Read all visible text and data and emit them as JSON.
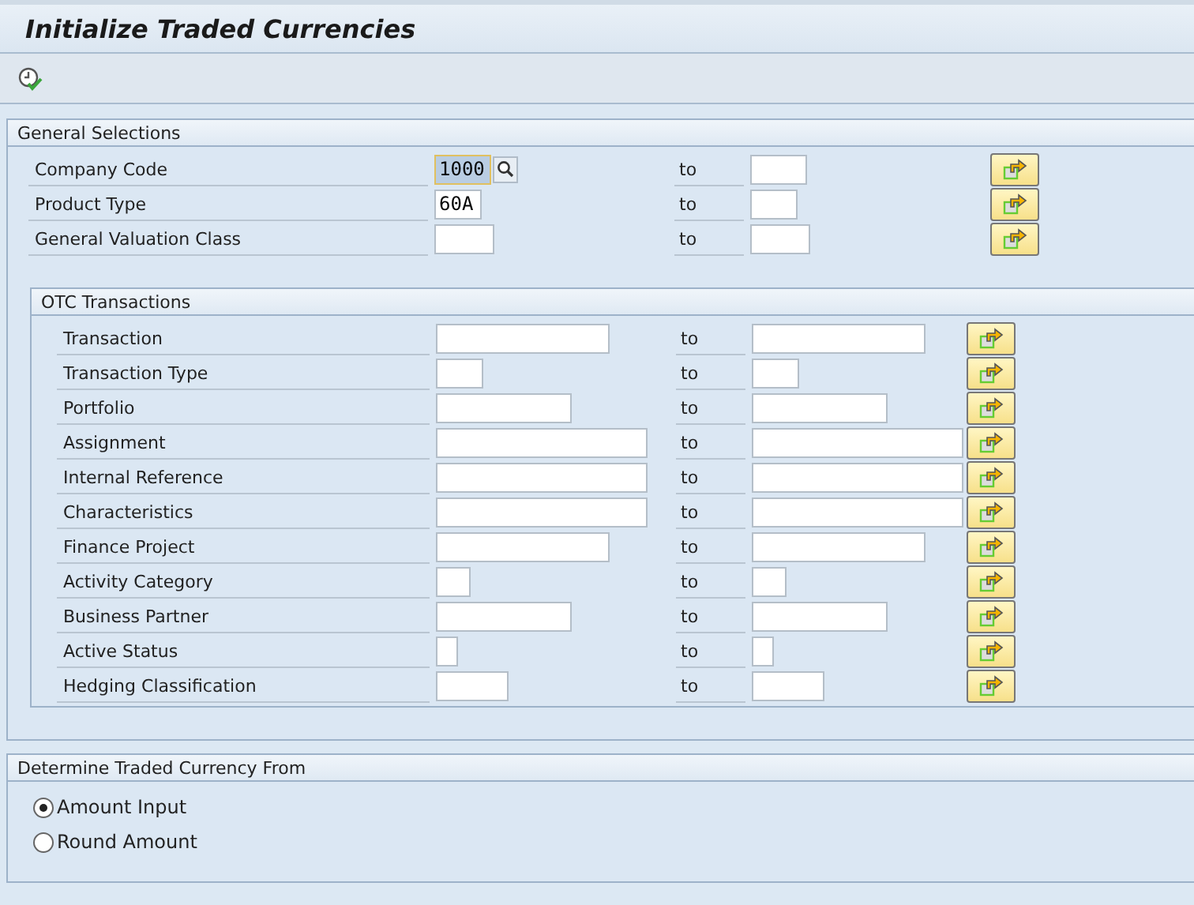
{
  "window": {
    "title": "Initialize Traded Currencies"
  },
  "general_selections": {
    "title": "General Selections",
    "rows": [
      {
        "label": "Company Code",
        "low": "1000",
        "to_label": "to",
        "high": "",
        "focused": true
      },
      {
        "label": "Product Type",
        "low": "60A",
        "to_label": "to",
        "high": "",
        "focused": false
      },
      {
        "label": "General Valuation Class",
        "low": "",
        "to_label": "to",
        "high": "",
        "focused": false
      }
    ]
  },
  "otc_transactions": {
    "title": "OTC Transactions",
    "rows": [
      {
        "label": "Transaction",
        "low": "",
        "to_label": "to",
        "high": ""
      },
      {
        "label": "Transaction Type",
        "low": "",
        "to_label": "to",
        "high": ""
      },
      {
        "label": "Portfolio",
        "low": "",
        "to_label": "to",
        "high": ""
      },
      {
        "label": "Assignment",
        "low": "",
        "to_label": "to",
        "high": ""
      },
      {
        "label": "Internal Reference",
        "low": "",
        "to_label": "to",
        "high": ""
      },
      {
        "label": "Characteristics",
        "low": "",
        "to_label": "to",
        "high": ""
      },
      {
        "label": "Finance Project",
        "low": "",
        "to_label": "to",
        "high": ""
      },
      {
        "label": "Activity Category",
        "low": "",
        "to_label": "to",
        "high": ""
      },
      {
        "label": "Business Partner",
        "low": "",
        "to_label": "to",
        "high": ""
      },
      {
        "label": "Active Status",
        "low": "",
        "to_label": "to",
        "high": ""
      },
      {
        "label": "Hedging Classification",
        "low": "",
        "to_label": "to",
        "high": ""
      }
    ]
  },
  "determine_from": {
    "title": "Determine Traded Currency From",
    "options": [
      {
        "label": "Amount Input",
        "selected": true
      },
      {
        "label": "Round Amount",
        "selected": false
      }
    ]
  }
}
